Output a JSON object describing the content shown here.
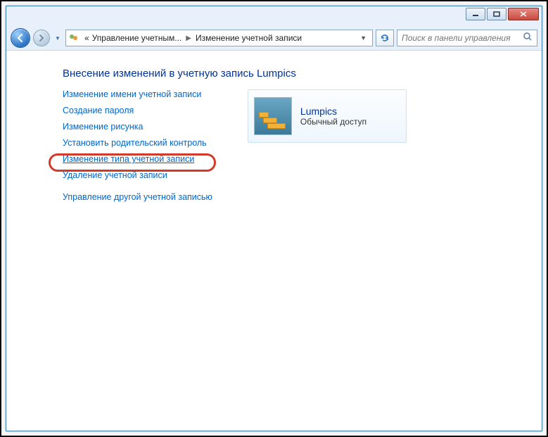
{
  "breadcrumb": {
    "prefix": "«",
    "seg1": "Управление учетным...",
    "seg2": "Изменение учетной записи"
  },
  "search": {
    "placeholder": "Поиск в панели управления"
  },
  "heading": "Внесение изменений в учетную запись Lumpics",
  "links": {
    "rename": "Изменение имени учетной записи",
    "create_pw": "Создание пароля",
    "change_pic": "Изменение рисунка",
    "parental": "Установить родительский контроль",
    "change_type": "Изменение типа учетной записи",
    "delete": "Удаление учетной записи",
    "manage_other": "Управление другой учетной записью"
  },
  "account": {
    "name": "Lumpics",
    "type": "Обычный доступ"
  }
}
